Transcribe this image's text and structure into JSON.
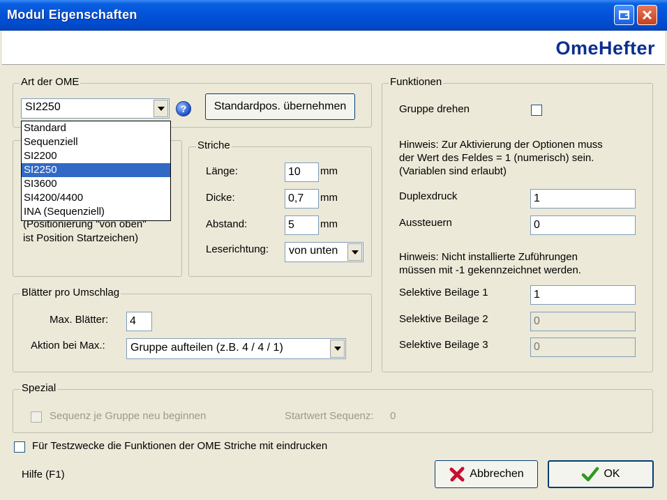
{
  "window": {
    "title": "Modul Eigenschaften",
    "brand": "OmeHefter"
  },
  "art": {
    "label": "Art der OME",
    "selected": "SI2250",
    "options": [
      "Standard",
      "Sequenziell",
      "SI2200",
      "SI2250",
      "SI3600",
      "SI4200/4400",
      "INA (Sequenziell)"
    ],
    "selected_index": 3,
    "standard_button": "Standardpos. übernehmen",
    "partial_text_line1": "(Positionierung \"von oben\"",
    "partial_text_line2": "ist Position Startzeichen)"
  },
  "striche": {
    "label": "Striche",
    "laenge_label": "Länge:",
    "laenge_value": "10",
    "laenge_unit": "mm",
    "dicke_label": "Dicke:",
    "dicke_value": "0,7",
    "dicke_unit": "mm",
    "abstand_label": "Abstand:",
    "abstand_value": "5",
    "abstand_unit": "mm",
    "leserichtung_label": "Leserichtung:",
    "leserichtung_value": "von unten"
  },
  "blaetter": {
    "label": "Blätter pro Umschlag",
    "max_label": "Max. Blätter:",
    "max_value": "4",
    "aktion_label": "Aktion bei Max.:",
    "aktion_value": "Gruppe aufteilen (z.B. 4 / 4 / 1)"
  },
  "funktionen": {
    "label": "Funktionen",
    "gruppe_drehen": "Gruppe drehen",
    "hinweis1_line1": "Hinweis: Zur Aktivierung der Optionen muss",
    "hinweis1_line2": "der Wert des Feldes = 1 (numerisch) sein.",
    "hinweis1_line3": "(Variablen sind erlaubt)",
    "duplex_label": "Duplexdruck",
    "duplex_value": "1",
    "aussteuern_label": "Aussteuern",
    "aussteuern_value": "0",
    "hinweis2_line1": "Hinweis: Nicht installierte Zuführungen",
    "hinweis2_line2": "müssen mit -1 gekennzeichnet werden.",
    "beilage1_label": "Selektive Beilage 1",
    "beilage1_value": "1",
    "beilage2_label": "Selektive Beilage 2",
    "beilage2_value": "0",
    "beilage3_label": "Selektive Beilage 3",
    "beilage3_value": "0"
  },
  "spezial": {
    "label": "Spezial",
    "sequenz_label": "Sequenz je Gruppe neu beginnen",
    "startwert_label": "Startwert Sequenz:",
    "startwert_value": "0"
  },
  "footer": {
    "test_label": "Für Testzwecke die Funktionen der OME Striche mit eindrucken",
    "hilfe": "Hilfe (F1)",
    "cancel": "Abbrechen",
    "ok": "OK"
  },
  "colors": {
    "titlebar": "#0152d8",
    "brand": "#0b2f8e",
    "selection": "#316ac5",
    "cancel_x": "#c8102e",
    "ok_check": "#2e9a1e"
  }
}
